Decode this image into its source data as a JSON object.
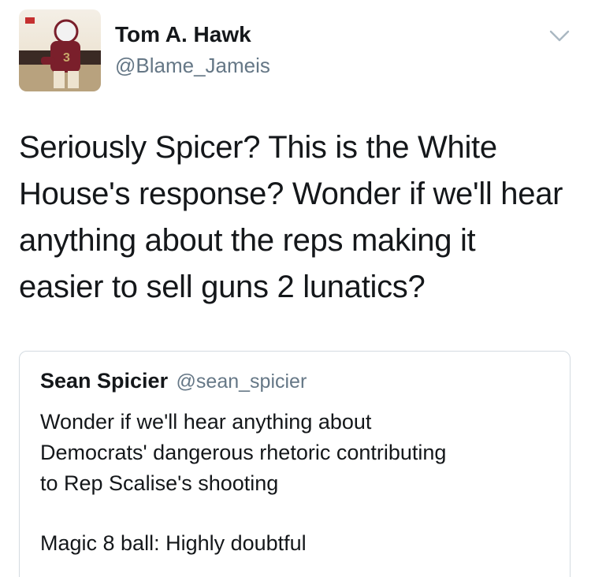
{
  "tweet": {
    "author_name": "Tom A. Hawk",
    "author_handle": "@Blame_Jameis",
    "avatar_icon": "user-avatar-photo",
    "menu_icon": "chevron-down-icon",
    "text_lines": [
      "Seriously Spicer? This is the White",
      "House's response? Wonder if we'll hear",
      "anything about the reps making it",
      "easier to sell guns 2 lunatics?"
    ]
  },
  "quoted_tweet": {
    "author_name": "Sean Spicier",
    "author_handle": "@sean_spicier",
    "text_lines": [
      "Wonder if we'll hear anything about",
      "Democrats' dangerous rhetoric contributing",
      "to Rep Scalise's shooting"
    ],
    "text_footer": "Magic 8 ball: Highly doubtful"
  },
  "colors": {
    "primary_text": "#14171a",
    "secondary_text": "#657786",
    "border": "#d4dbe1",
    "avatar_garnet": "#7a1f2b",
    "avatar_gold": "#c8a96a"
  }
}
